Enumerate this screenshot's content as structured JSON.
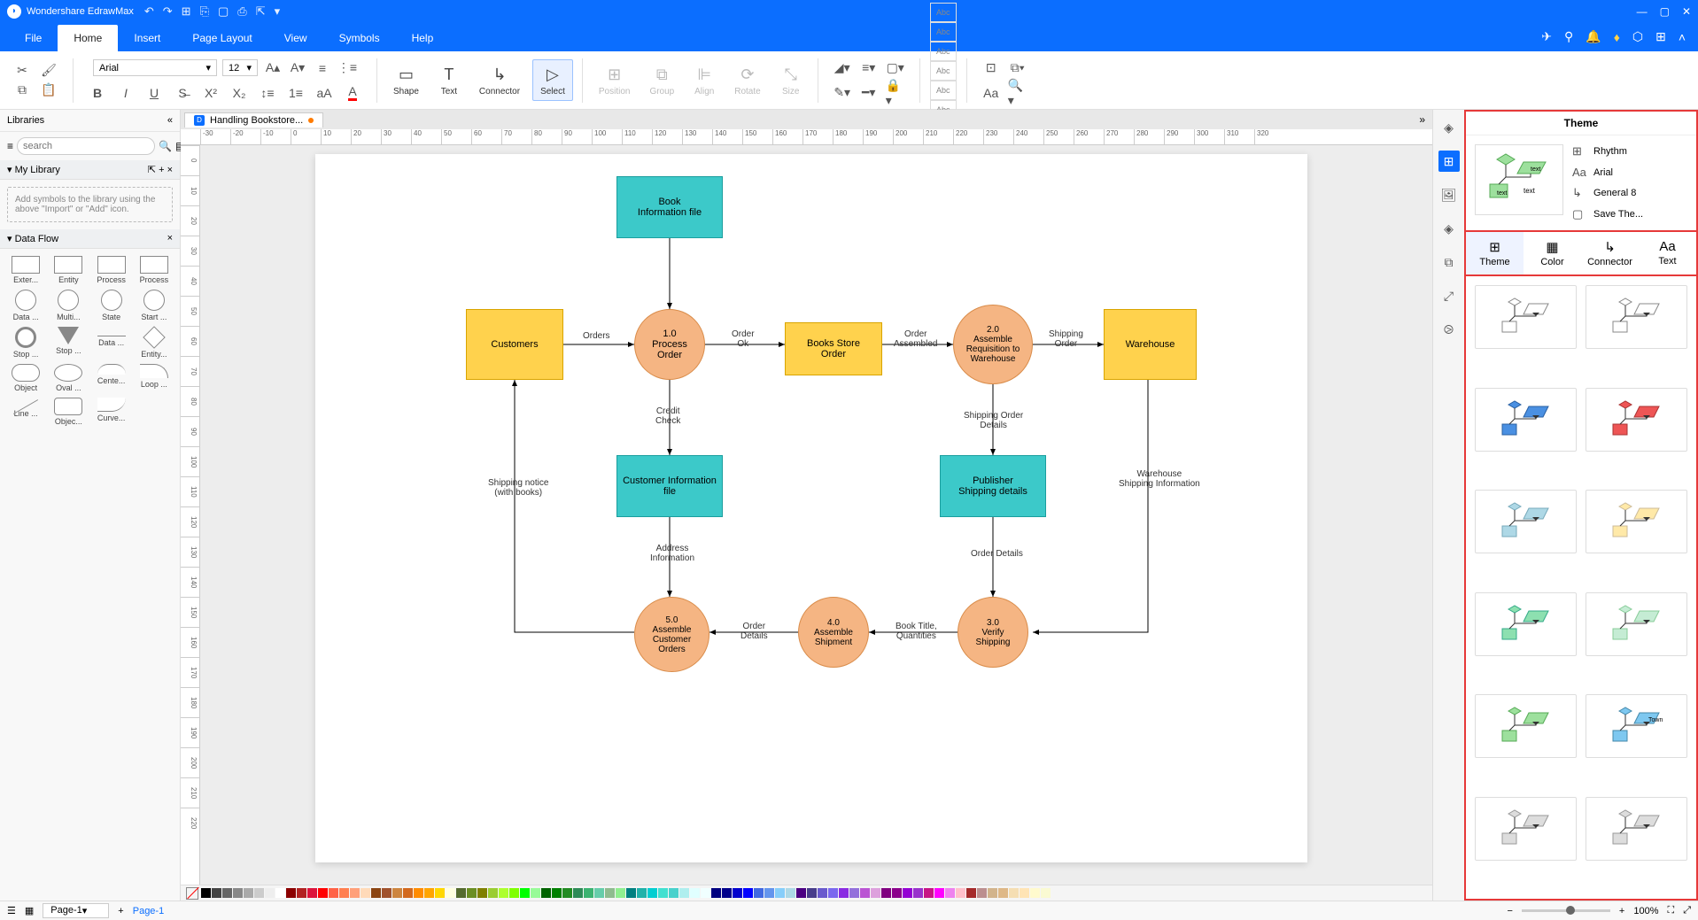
{
  "app": {
    "title": "Wondershare EdrawMax"
  },
  "menus": {
    "file": "File",
    "home": "Home",
    "insert": "Insert",
    "pagelayout": "Page Layout",
    "view": "View",
    "symbols": "Symbols",
    "help": "Help"
  },
  "ribbon": {
    "font": "Arial",
    "size": "12",
    "shape": "Shape",
    "text": "Text",
    "connector": "Connector",
    "select": "Select",
    "position": "Position",
    "group": "Group",
    "align": "Align",
    "rotate": "Rotate",
    "sizebtn": "Size",
    "styleSwatch": "Abc"
  },
  "doc": {
    "tab": "Handling Bookstore...",
    "modified": "●"
  },
  "lib": {
    "title": "Libraries",
    "searchPlaceholder": "search",
    "mylib": "My Library",
    "hint": "Add symbols to the library using the above \"Import\" or \"Add\" icon.",
    "dataflow": "Data Flow",
    "shapes": {
      "exter": "Exter...",
      "entity": "Entity",
      "process": "Process",
      "process2": "Process",
      "data": "Data ...",
      "multi": "Multi...",
      "state": "State",
      "start": "Start ...",
      "stop": "Stop ...",
      "stop2": "Stop ...",
      "data2": "Data ...",
      "entity2": "Entity...",
      "object": "Object",
      "oval": "Oval ...",
      "cente": "Cente...",
      "loop": "Loop ...",
      "line": "Line ...",
      "objec": "Objec...",
      "curve": "Curve..."
    }
  },
  "ruler": {
    "x": [
      "-30",
      "-20",
      "-10",
      "0",
      "10",
      "20",
      "30",
      "40",
      "50",
      "60",
      "70",
      "80",
      "90",
      "100",
      "110",
      "120",
      "130",
      "140",
      "150",
      "160",
      "170",
      "180",
      "190",
      "200",
      "210",
      "220",
      "230",
      "240",
      "250",
      "260",
      "270",
      "280",
      "290",
      "300",
      "310",
      "320"
    ],
    "y": [
      "0",
      "10",
      "20",
      "30",
      "40",
      "50",
      "60",
      "70",
      "80",
      "90",
      "100",
      "110",
      "120",
      "130",
      "140",
      "150",
      "160",
      "170",
      "180",
      "190",
      "200",
      "210",
      "220"
    ]
  },
  "diagram": {
    "nodes": {
      "bookinfo": "Book\nInformation file",
      "customers": "Customers",
      "process1": "1.0\nProcess Order",
      "bookstore": "Books Store\nOrder",
      "assemble2": "2.0\nAssemble\nRequisition to\nWarehouse",
      "warehouse": "Warehouse",
      "custinfo": "Customer Information\nfile",
      "pubship": "Publisher\nShipping details",
      "assemble5": "5.0\nAssemble\nCustomer\nOrders",
      "assemble4": "4.0\nAssemble\nShipment",
      "verify3": "3.0\nVerify\nShipping"
    },
    "labels": {
      "orders": "Orders",
      "orderok": "Order\nOk",
      "orderassembled": "Order\nAssembled",
      "shippingorder": "Shipping\nOrder",
      "creditcheck": "Credit\nCheck",
      "shippingorderdetails": "Shipping Order\nDetails",
      "addressinfo": "Address\nInformation",
      "orderdetails": "Order Details",
      "orderdetails2": "Order\nDetails",
      "booktitle": "Book Title,\nQuantities",
      "shippingnotice": "Shipping notice\n(with books)",
      "warehouseship": "Warehouse\nShipping Information"
    }
  },
  "theme": {
    "title": "Theme",
    "rhythm": "Rhythm",
    "arial": "Arial",
    "general8": "General 8",
    "save": "Save The...",
    "tabs": {
      "theme": "Theme",
      "color": "Color",
      "connector": "Connector",
      "text": "Text"
    },
    "townLabel": "Town"
  },
  "status": {
    "page": "Page-1",
    "pagetab": "Page-1",
    "zoom": "100%"
  },
  "colors": [
    "#000",
    "#444",
    "#666",
    "#888",
    "#aaa",
    "#ccc",
    "#eee",
    "#fff",
    "#8b0000",
    "#b22222",
    "#dc143c",
    "#ff0000",
    "#ff6347",
    "#ff7f50",
    "#ffa07a",
    "#ffdab9",
    "#8b4513",
    "#a0522d",
    "#cd853f",
    "#d2691e",
    "#ff8c00",
    "#ffa500",
    "#ffd700",
    "#ffffe0",
    "#556b2f",
    "#6b8e23",
    "#808000",
    "#9acd32",
    "#adff2f",
    "#7fff00",
    "#00ff00",
    "#98fb98",
    "#006400",
    "#008000",
    "#228b22",
    "#2e8b57",
    "#3cb371",
    "#66cdaa",
    "#8fbc8f",
    "#90ee90",
    "#008080",
    "#20b2aa",
    "#00ced1",
    "#40e0d0",
    "#48d1cc",
    "#afeeee",
    "#e0ffff",
    "#f0ffff",
    "#000080",
    "#00008b",
    "#0000cd",
    "#0000ff",
    "#4169e1",
    "#6495ed",
    "#87cefa",
    "#add8e6",
    "#4b0082",
    "#483d8b",
    "#6a5acd",
    "#7b68ee",
    "#8a2be2",
    "#9370db",
    "#ba55d3",
    "#dda0dd",
    "#800080",
    "#8b008b",
    "#9400d3",
    "#9932cc",
    "#c71585",
    "#ff00ff",
    "#ee82ee",
    "#ffc0cb",
    "#a52a2a",
    "#bc8f8f",
    "#d2b48c",
    "#deb887",
    "#f5deb3",
    "#ffe4b5",
    "#fffacd",
    "#fafad2"
  ]
}
